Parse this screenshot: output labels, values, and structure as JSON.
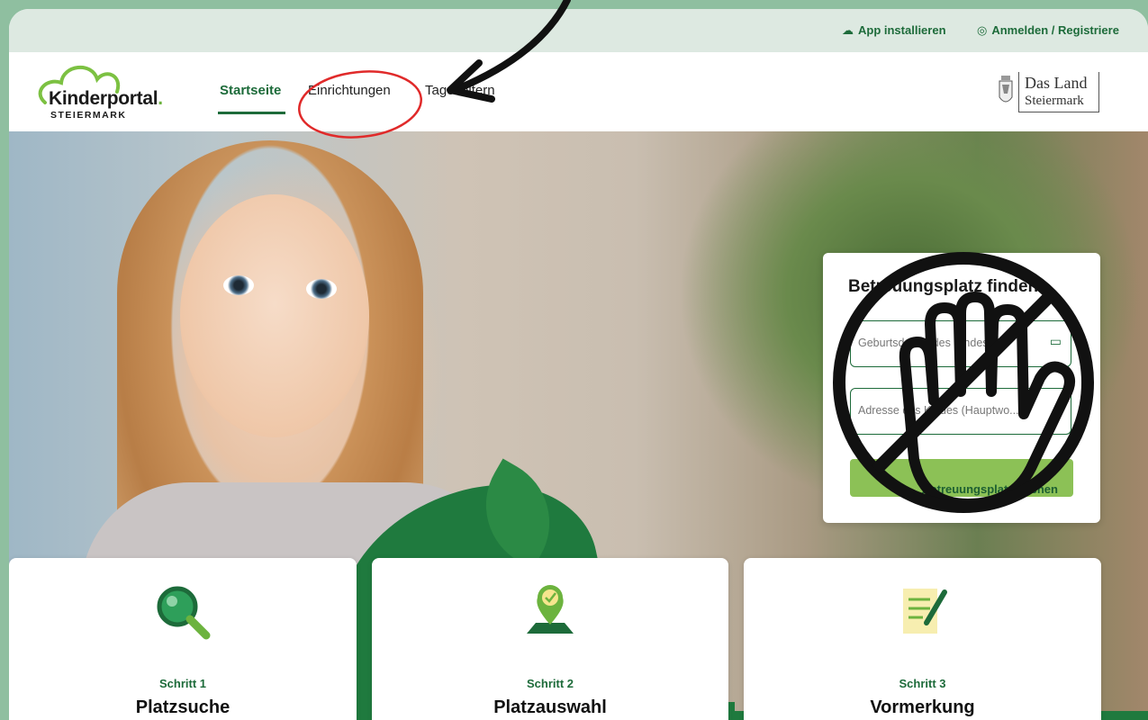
{
  "topbar": {
    "install_label": "App installieren",
    "install_icon": "cloud-download-icon",
    "login_label": "Anmelden / Registriere",
    "login_icon": "user-circle-icon"
  },
  "logo": {
    "name": "Kinderportal",
    "dot": ".",
    "subtitle": "STEIERMARK"
  },
  "nav": {
    "items": [
      {
        "label": "Startseite",
        "active": true
      },
      {
        "label": "Einrichtungen",
        "active": false
      },
      {
        "label": "Tageseltern",
        "active": false
      }
    ]
  },
  "land_logo": {
    "line1": "Das Land",
    "line2": "Steiermark"
  },
  "search": {
    "title": "Betreuungsplatz finden",
    "birthdate_placeholder": "Geburtsdatum des Kindes",
    "birthdate_icon": "calendar-icon",
    "address_placeholder": "Adresse des Kindes (Hauptwo...",
    "address_icon": "chevron-down-icon",
    "button_label": "Betreuungsplatz suchen",
    "button_icon": "search-icon"
  },
  "steps": [
    {
      "step": "Schritt 1",
      "title": "Platzsuche",
      "icon": "magnifier-icon"
    },
    {
      "step": "Schritt 2",
      "title": "Platzauswahl",
      "icon": "map-pin-check-icon"
    },
    {
      "step": "Schritt 3",
      "title": "Vormerkung",
      "icon": "document-pen-icon"
    }
  ],
  "colors": {
    "brand_green": "#1d6b3a",
    "accent_green": "#8cc156",
    "topbar_bg": "#dde9e1",
    "outer_bg": "#8fbfa0",
    "annotation_red": "#e02a2a"
  }
}
